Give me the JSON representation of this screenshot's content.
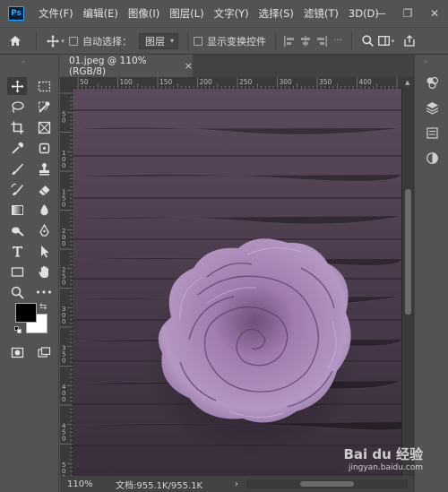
{
  "app": {
    "logo_text": "Ps",
    "menu": [
      "文件(F)",
      "编辑(E)",
      "图像(I)",
      "图层(L)",
      "文字(Y)",
      "选择(S)",
      "滤镜(T)",
      "3D(D)"
    ],
    "window_controls": [
      "—",
      "❐",
      "✕"
    ]
  },
  "options_bar": {
    "auto_select_label": "自动选择：",
    "layer_select_value": "图层",
    "show_transform_label": "显示变换控件"
  },
  "document": {
    "tab_title": "01.jpeg @ 110%(RGB/8)",
    "tab_close": "×",
    "ruler_h_ticks": [
      "50",
      "100",
      "150",
      "200",
      "250",
      "300",
      "350",
      "400"
    ],
    "ruler_v_ticks": [
      "5\n0",
      "1\n0\n0",
      "1\n5\n0",
      "2\n0\n0",
      "2\n5\n0",
      "3\n0\n0",
      "3\n5\n0",
      "4\n0\n0",
      "4\n5\n0",
      "5\n0\n0"
    ],
    "status_zoom": "110%",
    "status_doc": "文档:955.1K/955.1K",
    "status_arrow": "›"
  },
  "watermark": {
    "brand": "Bai du 经验",
    "url": "jingyan.baidu.com"
  },
  "colors": {
    "foreground": "#000000",
    "background": "#ffffff",
    "ui_bg": "#535353",
    "ps_accent": "#31a8ff",
    "rose": "#a782b5",
    "wood": "#4a3b4b"
  }
}
